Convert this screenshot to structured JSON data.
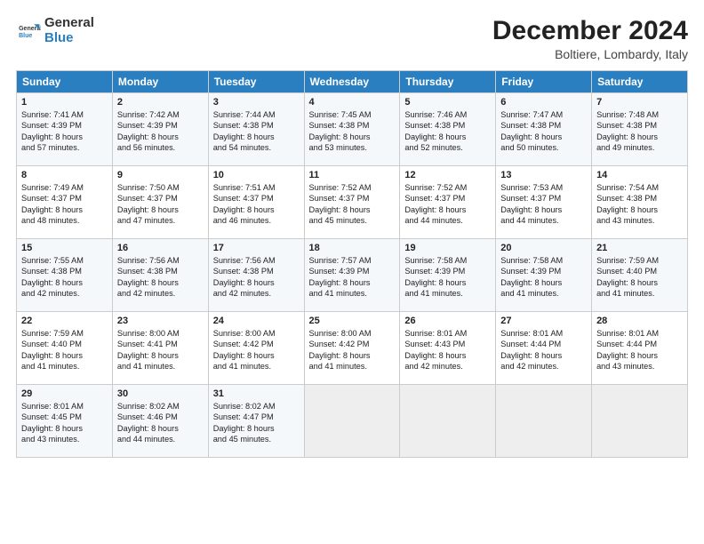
{
  "logo": {
    "line1": "General",
    "line2": "Blue"
  },
  "title": "December 2024",
  "location": "Boltiere, Lombardy, Italy",
  "days_header": [
    "Sunday",
    "Monday",
    "Tuesday",
    "Wednesday",
    "Thursday",
    "Friday",
    "Saturday"
  ],
  "weeks": [
    [
      {
        "num": "1",
        "lines": [
          "Sunrise: 7:41 AM",
          "Sunset: 4:39 PM",
          "Daylight: 8 hours",
          "and 57 minutes."
        ]
      },
      {
        "num": "2",
        "lines": [
          "Sunrise: 7:42 AM",
          "Sunset: 4:39 PM",
          "Daylight: 8 hours",
          "and 56 minutes."
        ]
      },
      {
        "num": "3",
        "lines": [
          "Sunrise: 7:44 AM",
          "Sunset: 4:38 PM",
          "Daylight: 8 hours",
          "and 54 minutes."
        ]
      },
      {
        "num": "4",
        "lines": [
          "Sunrise: 7:45 AM",
          "Sunset: 4:38 PM",
          "Daylight: 8 hours",
          "and 53 minutes."
        ]
      },
      {
        "num": "5",
        "lines": [
          "Sunrise: 7:46 AM",
          "Sunset: 4:38 PM",
          "Daylight: 8 hours",
          "and 52 minutes."
        ]
      },
      {
        "num": "6",
        "lines": [
          "Sunrise: 7:47 AM",
          "Sunset: 4:38 PM",
          "Daylight: 8 hours",
          "and 50 minutes."
        ]
      },
      {
        "num": "7",
        "lines": [
          "Sunrise: 7:48 AM",
          "Sunset: 4:38 PM",
          "Daylight: 8 hours",
          "and 49 minutes."
        ]
      }
    ],
    [
      {
        "num": "8",
        "lines": [
          "Sunrise: 7:49 AM",
          "Sunset: 4:37 PM",
          "Daylight: 8 hours",
          "and 48 minutes."
        ]
      },
      {
        "num": "9",
        "lines": [
          "Sunrise: 7:50 AM",
          "Sunset: 4:37 PM",
          "Daylight: 8 hours",
          "and 47 minutes."
        ]
      },
      {
        "num": "10",
        "lines": [
          "Sunrise: 7:51 AM",
          "Sunset: 4:37 PM",
          "Daylight: 8 hours",
          "and 46 minutes."
        ]
      },
      {
        "num": "11",
        "lines": [
          "Sunrise: 7:52 AM",
          "Sunset: 4:37 PM",
          "Daylight: 8 hours",
          "and 45 minutes."
        ]
      },
      {
        "num": "12",
        "lines": [
          "Sunrise: 7:52 AM",
          "Sunset: 4:37 PM",
          "Daylight: 8 hours",
          "and 44 minutes."
        ]
      },
      {
        "num": "13",
        "lines": [
          "Sunrise: 7:53 AM",
          "Sunset: 4:37 PM",
          "Daylight: 8 hours",
          "and 44 minutes."
        ]
      },
      {
        "num": "14",
        "lines": [
          "Sunrise: 7:54 AM",
          "Sunset: 4:38 PM",
          "Daylight: 8 hours",
          "and 43 minutes."
        ]
      }
    ],
    [
      {
        "num": "15",
        "lines": [
          "Sunrise: 7:55 AM",
          "Sunset: 4:38 PM",
          "Daylight: 8 hours",
          "and 42 minutes."
        ]
      },
      {
        "num": "16",
        "lines": [
          "Sunrise: 7:56 AM",
          "Sunset: 4:38 PM",
          "Daylight: 8 hours",
          "and 42 minutes."
        ]
      },
      {
        "num": "17",
        "lines": [
          "Sunrise: 7:56 AM",
          "Sunset: 4:38 PM",
          "Daylight: 8 hours",
          "and 42 minutes."
        ]
      },
      {
        "num": "18",
        "lines": [
          "Sunrise: 7:57 AM",
          "Sunset: 4:39 PM",
          "Daylight: 8 hours",
          "and 41 minutes."
        ]
      },
      {
        "num": "19",
        "lines": [
          "Sunrise: 7:58 AM",
          "Sunset: 4:39 PM",
          "Daylight: 8 hours",
          "and 41 minutes."
        ]
      },
      {
        "num": "20",
        "lines": [
          "Sunrise: 7:58 AM",
          "Sunset: 4:39 PM",
          "Daylight: 8 hours",
          "and 41 minutes."
        ]
      },
      {
        "num": "21",
        "lines": [
          "Sunrise: 7:59 AM",
          "Sunset: 4:40 PM",
          "Daylight: 8 hours",
          "and 41 minutes."
        ]
      }
    ],
    [
      {
        "num": "22",
        "lines": [
          "Sunrise: 7:59 AM",
          "Sunset: 4:40 PM",
          "Daylight: 8 hours",
          "and 41 minutes."
        ]
      },
      {
        "num": "23",
        "lines": [
          "Sunrise: 8:00 AM",
          "Sunset: 4:41 PM",
          "Daylight: 8 hours",
          "and 41 minutes."
        ]
      },
      {
        "num": "24",
        "lines": [
          "Sunrise: 8:00 AM",
          "Sunset: 4:42 PM",
          "Daylight: 8 hours",
          "and 41 minutes."
        ]
      },
      {
        "num": "25",
        "lines": [
          "Sunrise: 8:00 AM",
          "Sunset: 4:42 PM",
          "Daylight: 8 hours",
          "and 41 minutes."
        ]
      },
      {
        "num": "26",
        "lines": [
          "Sunrise: 8:01 AM",
          "Sunset: 4:43 PM",
          "Daylight: 8 hours",
          "and 42 minutes."
        ]
      },
      {
        "num": "27",
        "lines": [
          "Sunrise: 8:01 AM",
          "Sunset: 4:44 PM",
          "Daylight: 8 hours",
          "and 42 minutes."
        ]
      },
      {
        "num": "28",
        "lines": [
          "Sunrise: 8:01 AM",
          "Sunset: 4:44 PM",
          "Daylight: 8 hours",
          "and 43 minutes."
        ]
      }
    ],
    [
      {
        "num": "29",
        "lines": [
          "Sunrise: 8:01 AM",
          "Sunset: 4:45 PM",
          "Daylight: 8 hours",
          "and 43 minutes."
        ]
      },
      {
        "num": "30",
        "lines": [
          "Sunrise: 8:02 AM",
          "Sunset: 4:46 PM",
          "Daylight: 8 hours",
          "and 44 minutes."
        ]
      },
      {
        "num": "31",
        "lines": [
          "Sunrise: 8:02 AM",
          "Sunset: 4:47 PM",
          "Daylight: 8 hours",
          "and 45 minutes."
        ]
      },
      null,
      null,
      null,
      null
    ]
  ]
}
